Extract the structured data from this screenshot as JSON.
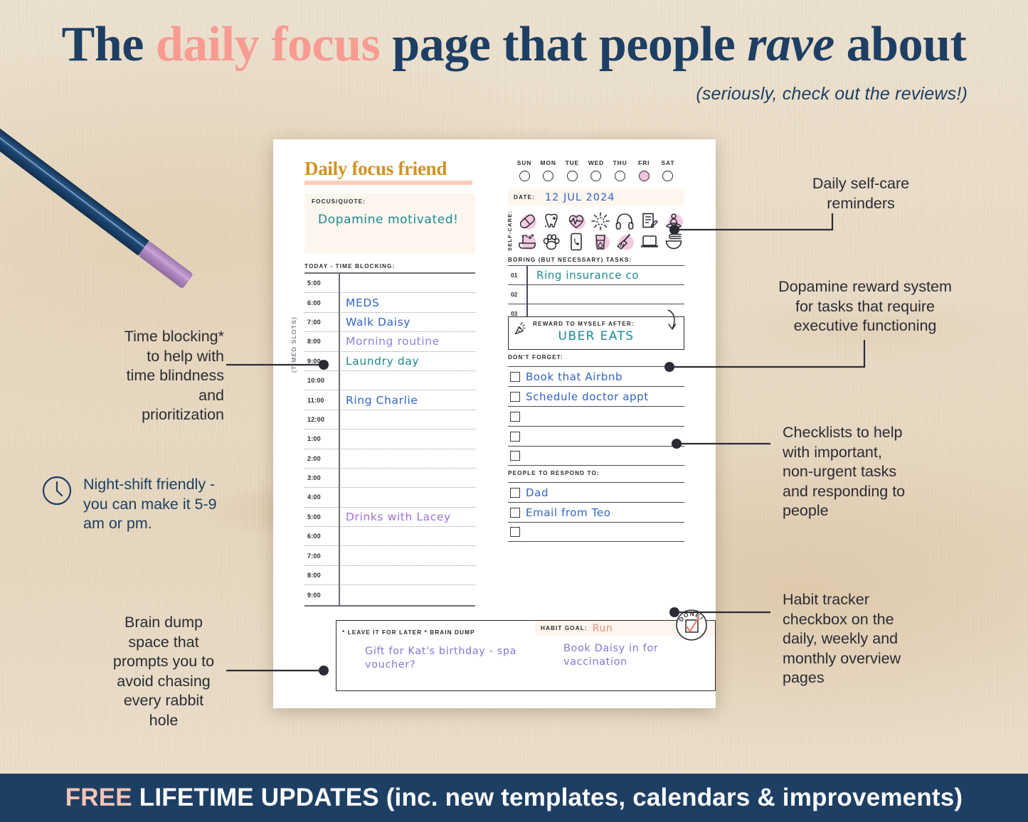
{
  "headline": {
    "part1": "The ",
    "highlight": "daily focus",
    "part2": " page that people ",
    "italic": "rave",
    "part3": " about",
    "subhead": "(seriously, check out the reviews!)",
    "accent_pink": "#f99b91",
    "navy": "#1d3f64"
  },
  "planner": {
    "title": "Daily focus friend",
    "focus_label": "FOCUS/QUOTE:",
    "focus_value": "Dopamine motivated!",
    "time_blocking_label": "TODAY - TIME BLOCKING:",
    "timed_slots_label": "(TIMED SLOTS)",
    "week_days": [
      "SUN",
      "MON",
      "TUE",
      "WED",
      "THU",
      "FRI",
      "SAT"
    ],
    "week_selected": "FRI",
    "date_label": "DATE:",
    "date_value": "12 JUL 2024",
    "selfcare_label": "SELF-CARE:",
    "selfcare_icons": [
      "pill-icon",
      "tooth-icon",
      "heart-pulse-icon",
      "sun-icon",
      "headphones-icon",
      "journal-icon",
      "meditation-icon",
      "bath-icon",
      "paw-print-icon",
      "phone-call-icon",
      "water-glass-icon",
      "broom-icon",
      "laptop-icon",
      "noodle-bowl-icon"
    ],
    "time_slots": [
      {
        "time": "5:00",
        "task": "",
        "color": ""
      },
      {
        "time": "6:00",
        "task": "MEDS",
        "color": "#3163c4"
      },
      {
        "time": "7:00",
        "task": "Walk Daisy",
        "color": "#3163c4"
      },
      {
        "time": "8:00",
        "task": "Morning routine",
        "color": "#8a82dd"
      },
      {
        "time": "9:00",
        "task": "Laundry day",
        "color": "#1a8a92"
      },
      {
        "time": "10:00",
        "task": "",
        "color": ""
      },
      {
        "time": "11:00",
        "task": "Ring Charlie",
        "color": "#3163c4"
      },
      {
        "time": "12:00",
        "task": "",
        "color": ""
      },
      {
        "time": "1:00",
        "task": "",
        "color": ""
      },
      {
        "time": "2:00",
        "task": "",
        "color": ""
      },
      {
        "time": "3:00",
        "task": "",
        "color": ""
      },
      {
        "time": "4:00",
        "task": "",
        "color": ""
      },
      {
        "time": "5:00",
        "task": "Drinks with Lacey",
        "color": "#9b6fd4"
      },
      {
        "time": "6:00",
        "task": "",
        "color": ""
      },
      {
        "time": "7:00",
        "task": "",
        "color": ""
      },
      {
        "time": "8:00",
        "task": "",
        "color": ""
      },
      {
        "time": "9:00",
        "task": "",
        "color": ""
      }
    ],
    "boring_tasks_label": "BORING (BUT NECESSARY) TASKS:",
    "boring_tasks": [
      {
        "num": "01",
        "text": "Ring insurance co"
      },
      {
        "num": "02",
        "text": ""
      },
      {
        "num": "03",
        "text": ""
      }
    ],
    "reward_label": "REWARD TO MYSELF AFTER:",
    "reward_value": "UBER EATS",
    "dont_forget_label": "DON'T FORGET:",
    "dont_forget": [
      "Book that Airbnb",
      "Schedule doctor appt",
      "",
      "",
      ""
    ],
    "respond_label": "PEOPLE TO RESPOND TO:",
    "respond": [
      "Dad",
      "Email from Teo",
      ""
    ],
    "brain_dump_label": "* LEAVE IT FOR LATER * BRAIN DUMP",
    "brain_dump_value": "Gift for Kat's\nbirthday - spa\nvoucher?",
    "habit_goal_label": "HABIT GOAL:",
    "habit_goal_value": "Run",
    "habit_note_value": "Book Daisy in for\nvaccination",
    "done_stamp_label": "DONE!"
  },
  "annotations": {
    "time_blocking": "Time blocking*\nto help with\ntime blindness\nand\nprioritization",
    "night_shift": "Night-shift friendly -\nyou can make it 5-9\nam or pm.",
    "brain_dump": "Brain dump\nspace that\nprompts you to\navoid chasing\nevery rabbit\nhole",
    "self_care": "Daily self-care\nreminders",
    "dopamine": "Dopamine reward system\nfor tasks that require\nexecutive functioning",
    "checklists": "Checklists to help\nwith important,\nnon-urgent tasks\nand responding to\npeople",
    "habit_tracker": "Habit tracker\ncheckbox on the\ndaily, weekly and\nmonthly overview\npages"
  },
  "banner": {
    "free": "FREE",
    "rest": " LIFETIME UPDATES (inc. new templates, calendars & improvements)"
  }
}
